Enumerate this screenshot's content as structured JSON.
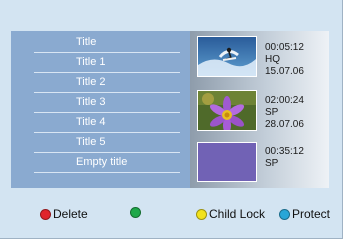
{
  "titles": {
    "header": "Title",
    "items": [
      "Title 1",
      "Title 2",
      "Title 3",
      "Title 4",
      "Title 5",
      "Empty title"
    ]
  },
  "previews": [
    {
      "duration": "00:05:12",
      "quality": "HQ",
      "date": "15.07.06",
      "thumbnail": "surfer-thumbnail"
    },
    {
      "duration": "02:00:24",
      "quality": "SP",
      "date": "28.07.06",
      "thumbnail": "flower-thumbnail"
    },
    {
      "duration": "00:35:12",
      "quality": "SP",
      "date": "",
      "thumbnail": "empty-thumbnail"
    }
  ],
  "legend": {
    "delete": {
      "label": "Delete",
      "color": "#e0242c"
    },
    "green": {
      "label": "",
      "color": "#1fa84a"
    },
    "child_lock": {
      "label": "Child Lock",
      "color": "#f2e21c"
    },
    "protect": {
      "label": "Protect",
      "color": "#28a6d8"
    }
  },
  "colors": {
    "background": "#d3e4f2",
    "panel": "#8aaad0"
  }
}
